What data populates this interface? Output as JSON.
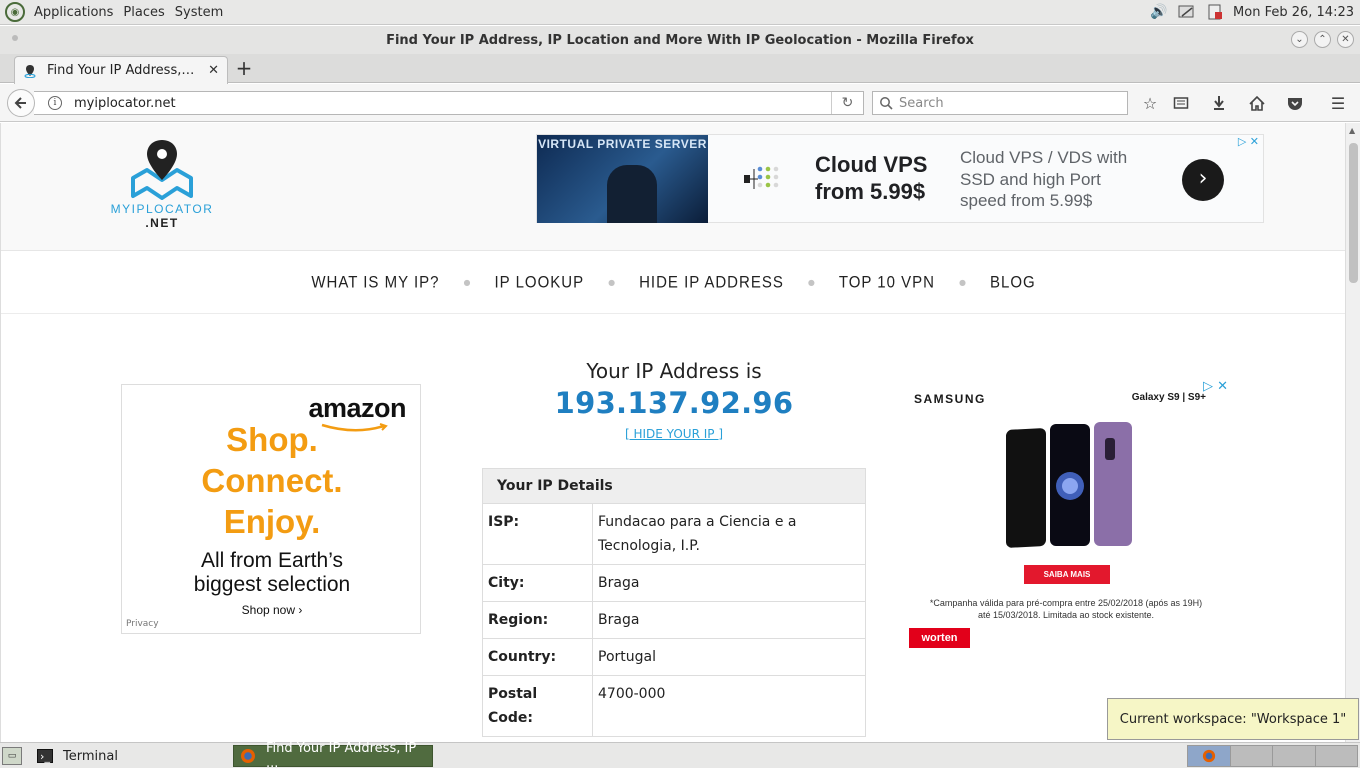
{
  "top_panel": {
    "menus": [
      "Applications",
      "Places",
      "System"
    ],
    "clock": "Mon Feb 26, 14:23"
  },
  "window": {
    "title": "Find Your IP Address, IP Location and More With IP Geolocation - Mozilla Firefox"
  },
  "tab": {
    "title": "Find Your IP Address,…",
    "new_tab_symbol": "+"
  },
  "navbar": {
    "url": "myiplocator.net",
    "search_placeholder": "Search"
  },
  "site": {
    "logo_line1": "MYIPLOCATOR",
    "logo_line2": ".NET",
    "nav": [
      "WHAT IS MY IP?",
      "IP LOOKUP",
      "HIDE IP ADDRESS",
      "TOP 10 VPN",
      "BLOG"
    ]
  },
  "top_ad": {
    "image_text": "VIRTUAL PRIVATE SERVER",
    "headline_line1": "Cloud VPS",
    "headline_line2": "from 5.99$",
    "description": "Cloud VPS / VDS with SSD and high Port speed from 5.99$"
  },
  "amazon_ad": {
    "logo": "amazon",
    "tagline": [
      "Shop.",
      "Connect.",
      "Enjoy."
    ],
    "sub_line1": "All from Earth’s",
    "sub_line2": "biggest selection",
    "shop_now": "Shop now ›",
    "privacy": "Privacy"
  },
  "ip": {
    "heading": "Your IP Address is",
    "address": "193.137.92.96",
    "hide_link": "[ HIDE YOUR IP ]"
  },
  "details": {
    "title": "Your IP Details",
    "rows": [
      {
        "label": "ISP:",
        "value": "Fundacao para a Ciencia e a Tecnologia, I.P."
      },
      {
        "label": "City:",
        "value": "Braga"
      },
      {
        "label": "Region:",
        "value": "Braga"
      },
      {
        "label": "Country:",
        "value": "Portugal"
      },
      {
        "label": "Postal Code:",
        "value": "4700-000"
      }
    ]
  },
  "samsung_ad": {
    "brand": "SAMSUNG",
    "model": "Galaxy S9 | S9+",
    "cta": "SAIBA MAIS",
    "fine_line1": "*Campanha válida para pré-compra entre 25/02/2018 (após as 19H)",
    "fine_line2": "até 15/03/2018. Limitada ao stock existente.",
    "retailer": "worten"
  },
  "workspace_tooltip": "Current workspace: \"Workspace 1\"",
  "taskbar": {
    "terminal": "Terminal",
    "firefox": "Find Your IP Address, IP ..."
  }
}
